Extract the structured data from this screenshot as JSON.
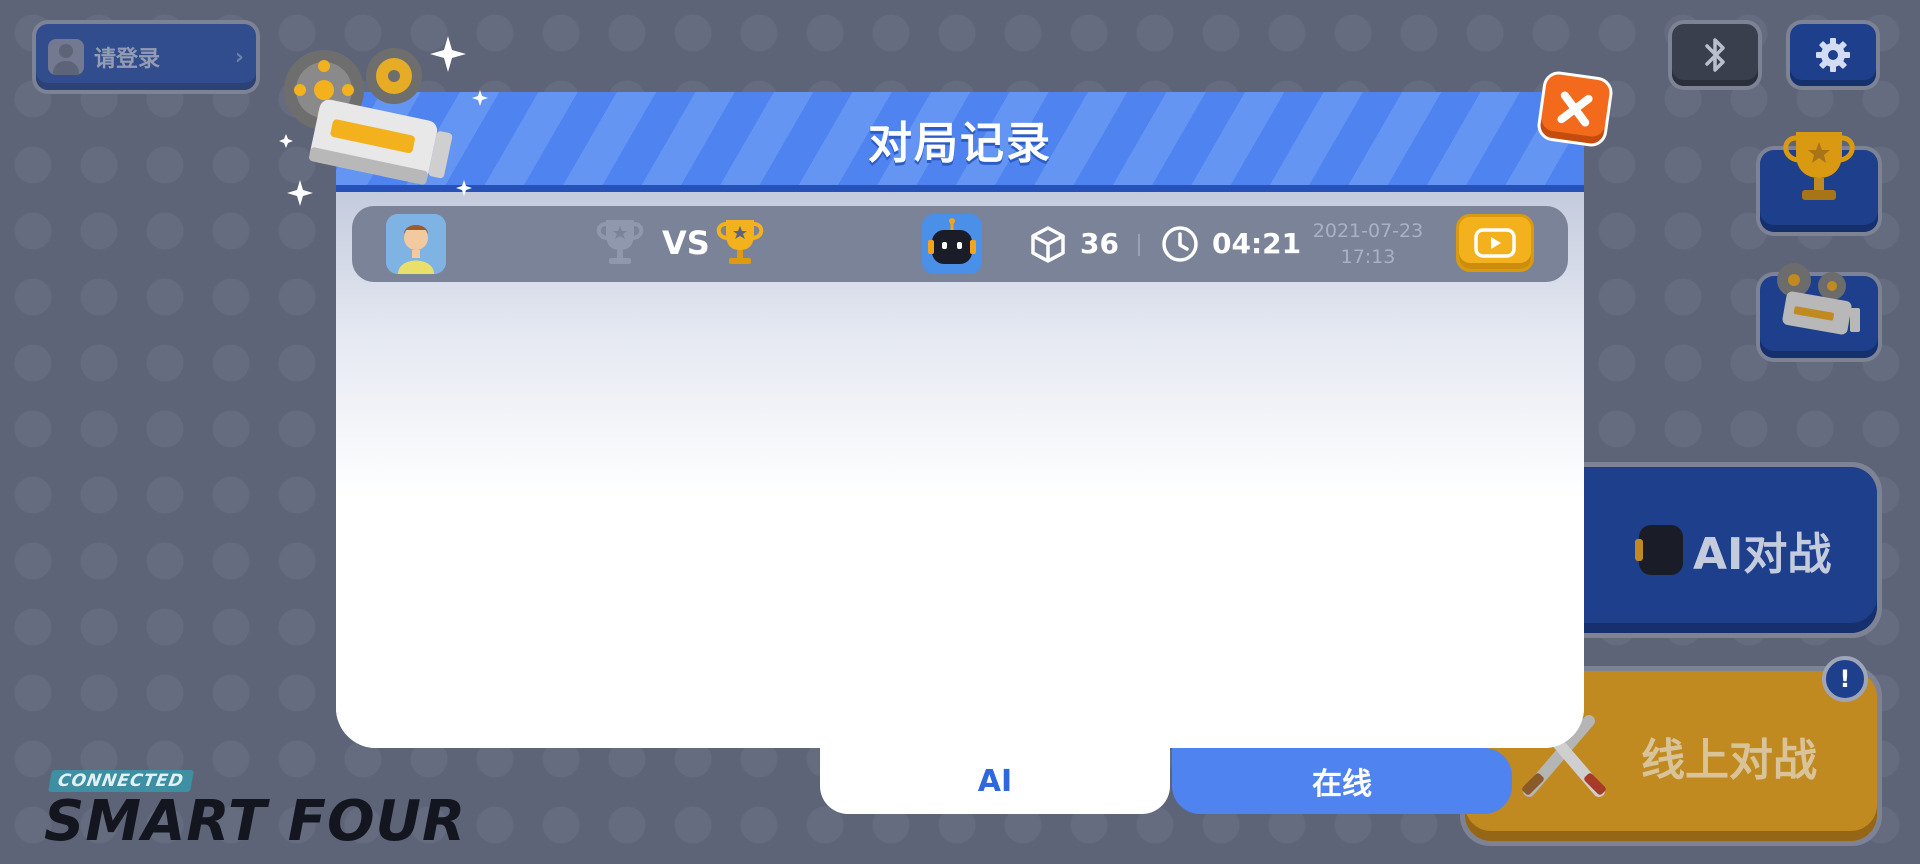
{
  "topbar": {
    "login_label": "请登录",
    "login_arrow": "›"
  },
  "icons": {
    "bluetooth": "bluetooth-icon",
    "settings": "gear-icon",
    "trophy": "trophy-icon",
    "projector": "film-projector-icon",
    "close": "close-icon"
  },
  "side_buttons": {
    "ai_battle_label": "AI对战",
    "online_battle_label": "线上对战",
    "notice_badge": "!"
  },
  "logo": {
    "connected": "CONNECTED",
    "name": "SMART FOUR"
  },
  "modal": {
    "title": "对局记录",
    "records": [
      {
        "vs_label": "VS",
        "moves": "36",
        "duration": "04:21",
        "date": "2021-07-23",
        "time": "17:13"
      }
    ]
  },
  "tabs": [
    {
      "label": "AI",
      "active": true
    },
    {
      "label": "在线",
      "active": false
    }
  ],
  "colors": {
    "background": "#5d6478",
    "modal_header": "#4f83ef",
    "primary_blue": "#1d3f8c",
    "accent_orange": "#f36a1c",
    "gold": "#f3b21d",
    "row_bg": "#7b8399"
  }
}
